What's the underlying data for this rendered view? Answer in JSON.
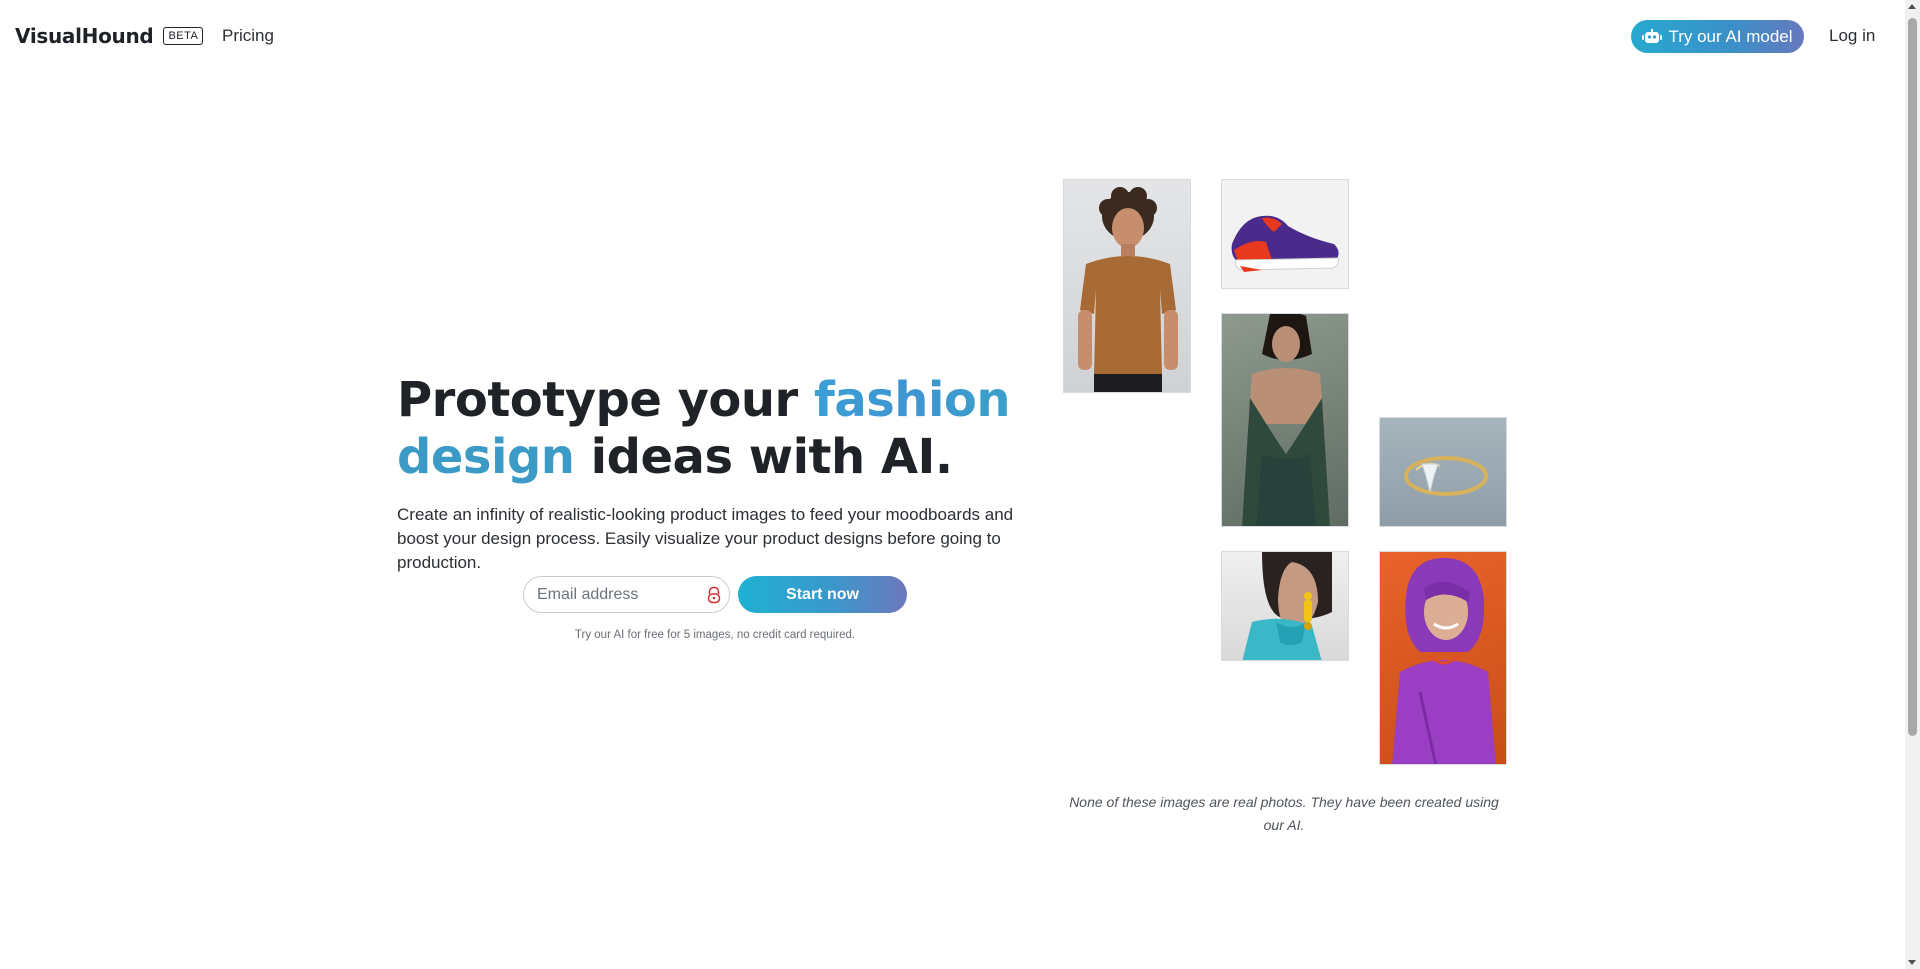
{
  "nav": {
    "brand": "VisualHound",
    "badge": "BETA",
    "pricing": "Pricing",
    "try_ai": "Try our AI model",
    "login": "Log in"
  },
  "hero": {
    "title_part1": "Prototype your ",
    "title_highlight_1": "fashion",
    "title_highlight_2": "design",
    "title_part2": " ideas with AI.",
    "description": "Create an infinity of realistic-looking product images to feed your moodboards and boost your design process. Easily visualize your product designs before going to production.",
    "email_placeholder": "Email address",
    "start_button": "Start now",
    "note": "Try our AI for free for 5 images, no credit card required."
  },
  "gallery": {
    "images": [
      {
        "subject": "man in brown t-shirt"
      },
      {
        "subject": "purple and red sneaker"
      },
      {
        "subject": "woman in green dress"
      },
      {
        "subject": "gold ring with diamond"
      },
      {
        "subject": "woman with yellow earrings and teal scarf"
      },
      {
        "subject": "smiling woman with purple hair on orange background"
      }
    ],
    "caption": "None of these images are real photos. They have been created using our AI."
  },
  "colors": {
    "accent_start": "#1fb1d2",
    "accent_end": "#6d78bd",
    "highlight": "#3b9ac6"
  }
}
